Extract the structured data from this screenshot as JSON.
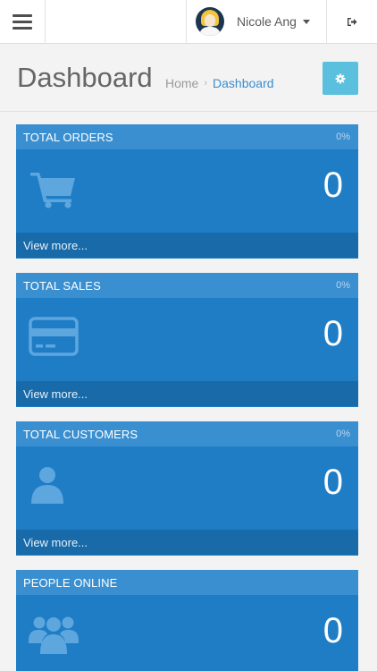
{
  "user": {
    "name": "Nicole Ang"
  },
  "page": {
    "title": "Dashboard"
  },
  "breadcrumb": {
    "home": "Home",
    "separator": "›",
    "current": "Dashboard"
  },
  "colors": {
    "card_bg": "#1f7dc5",
    "card_header": "#3a8fd0",
    "card_footer": "#186aa9",
    "settings_button": "#5bc0de",
    "link": "#3a8ecf"
  },
  "cards": [
    {
      "title": "TOTAL ORDERS",
      "percent": "0%",
      "value": "0",
      "more": "View more...",
      "icon": "cart-icon"
    },
    {
      "title": "TOTAL SALES",
      "percent": "0%",
      "value": "0",
      "more": "View more...",
      "icon": "credit-card-icon"
    },
    {
      "title": "TOTAL CUSTOMERS",
      "percent": "0%",
      "value": "0",
      "more": "View more...",
      "icon": "user-icon"
    },
    {
      "title": "PEOPLE ONLINE",
      "value": "0",
      "icon": "users-icon"
    }
  ]
}
